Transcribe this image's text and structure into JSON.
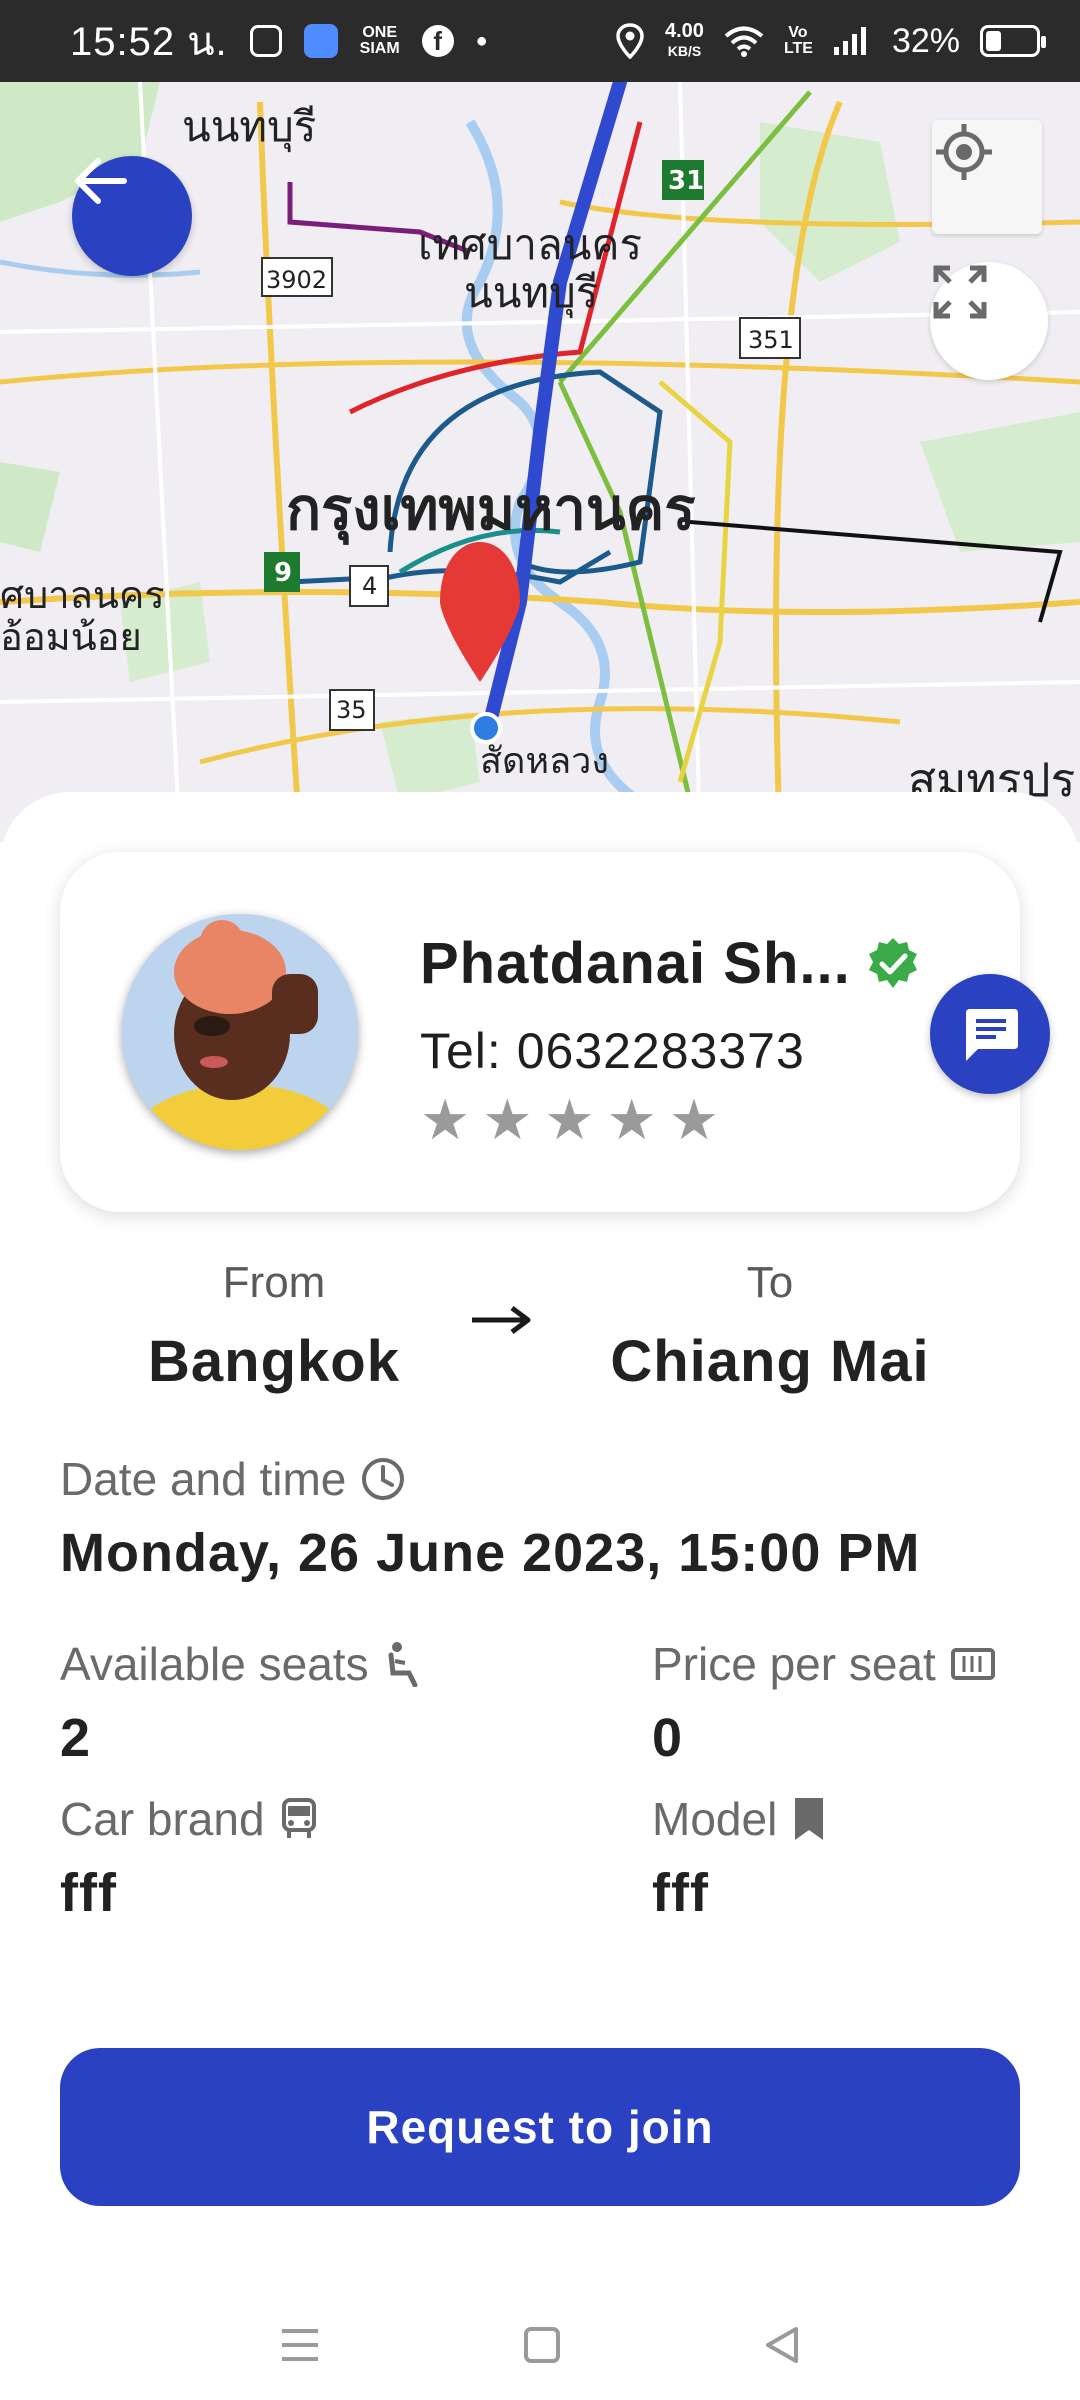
{
  "status_bar": {
    "time": "15:52 น.",
    "carrier_badge": "ONE SIAM",
    "speed": "4.00",
    "speed_unit": "KB/S",
    "network": "Vo LTE",
    "battery": "32%",
    "battery_level": 0.32
  },
  "map": {
    "labels": {
      "nonthaburi": "นนทบุรี",
      "nonthaburi_city_1": "เทศบาลนคร",
      "nonthaburi_city_2": "นนทบุรี",
      "bangkok": "กรุงเทพมหานคร",
      "west_city_1": "ศบาลนคร",
      "west_city_2": "อ้อมน้อย",
      "sathorn": "สัดหลวง",
      "samut": "สมุทรปร"
    },
    "route_shields": {
      "r3902": "3902",
      "r31": "31",
      "r351": "351",
      "r9": "9",
      "r4": "4",
      "r35": "35"
    }
  },
  "driver": {
    "name": "Phatdanai Sh...",
    "phone": "Tel: 0632283373",
    "rating_stars": 5,
    "rating_filled": 0,
    "verified": true
  },
  "route": {
    "from_label": "From",
    "from_value": "Bangkok",
    "to_label": "To",
    "to_value": "Chiang Mai"
  },
  "details": {
    "datetime_label": "Date and time",
    "datetime_value": "Monday, 26 June 2023, 15:00 PM",
    "seats_label": "Available seats",
    "seats_value": "2",
    "price_label": "Price per seat",
    "price_value": "0",
    "brand_label": "Car brand",
    "brand_value": "fff",
    "model_label": "Model",
    "model_value": "fff"
  },
  "actions": {
    "join_label": "Request to join"
  },
  "colors": {
    "primary": "#2A41C2",
    "verified": "#3BAA48",
    "marker": "#E53935"
  }
}
